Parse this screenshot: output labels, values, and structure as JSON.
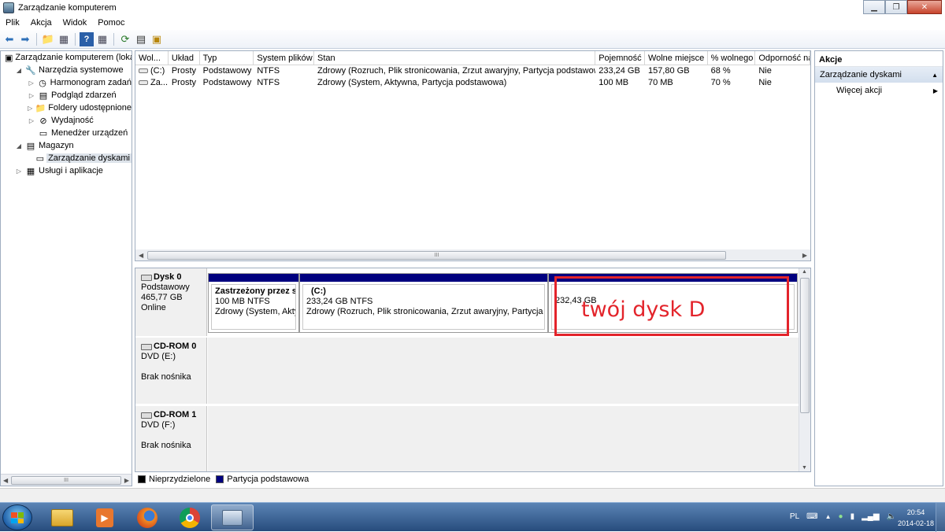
{
  "window": {
    "title": "Zarządzanie komputerem"
  },
  "menu": [
    "Plik",
    "Akcja",
    "Widok",
    "Pomoc"
  ],
  "tree": {
    "items": [
      {
        "label": "Zarządzanie komputerem (loka",
        "level": 0,
        "arrow": "",
        "icon": "computer-management-icon"
      },
      {
        "label": "Narzędzia systemowe",
        "level": 1,
        "arrow": "◢",
        "icon": "system-tools-icon"
      },
      {
        "label": "Harmonogram zadań",
        "level": 2,
        "arrow": "▷",
        "icon": "clock-icon"
      },
      {
        "label": "Podgląd zdarzeń",
        "level": 2,
        "arrow": "▷",
        "icon": "event-viewer-icon"
      },
      {
        "label": "Foldery udostępnione",
        "level": 2,
        "arrow": "▷",
        "icon": "shared-folder-icon"
      },
      {
        "label": "Wydajność",
        "level": 2,
        "arrow": "▷",
        "icon": "performance-icon"
      },
      {
        "label": "Menedżer urządzeń",
        "level": 2,
        "arrow": "",
        "icon": "device-manager-icon"
      },
      {
        "label": "Magazyn",
        "level": 1,
        "arrow": "◢",
        "icon": "storage-icon"
      },
      {
        "label": "Zarządzanie dyskami",
        "level": 2,
        "arrow": "",
        "icon": "disk-management-icon",
        "selected": true
      },
      {
        "label": "Usługi i aplikacje",
        "level": 1,
        "arrow": "▷",
        "icon": "services-icon"
      }
    ]
  },
  "volumes": {
    "columns": [
      "Wol...",
      "Układ",
      "Typ",
      "System plików",
      "Stan",
      "Pojemność",
      "Wolne miejsce",
      "% wolnego",
      "Odporność na"
    ],
    "rows": [
      [
        "(C:)",
        "Prosty",
        "Podstawowy",
        "NTFS",
        "Zdrowy (Rozruch, Plik stronicowania, Zrzut awaryjny, Partycja podstawowa)",
        "233,24 GB",
        "157,80 GB",
        "68 %",
        "Nie"
      ],
      [
        "Za...",
        "Prosty",
        "Podstawowy",
        "NTFS",
        "Zdrowy (System, Aktywna, Partycja podstawowa)",
        "100 MB",
        "70 MB",
        "70 %",
        "Nie"
      ]
    ]
  },
  "disks": {
    "disk0": {
      "name": "Dysk 0",
      "type": "Podstawowy",
      "size": "465,77 GB",
      "status": "Online",
      "partitions": [
        {
          "name": "Zastrzeżony przez sys",
          "size": "100 MB NTFS",
          "status": "Zdrowy (System, Aktyw"
        },
        {
          "name": "(C:)",
          "size": "233,24 GB NTFS",
          "status": "Zdrowy (Rozruch, Plik stronicowania, Zrzut awaryjny, Partycja poc"
        },
        {
          "name": "",
          "size": "232,43 GB",
          "status": ""
        }
      ]
    },
    "cdrom0": {
      "name": "CD-ROM 0",
      "drive": "DVD (E:)",
      "status": "Brak nośnika"
    },
    "cdrom1": {
      "name": "CD-ROM 1",
      "drive": "DVD (F:)",
      "status": "Brak nośnika"
    }
  },
  "legend": [
    {
      "label": "Nieprzydzielone",
      "color": "#000000"
    },
    {
      "label": "Partycja podstawowa",
      "color": "#00007f"
    }
  ],
  "actions": {
    "header": "Akcje",
    "section": "Zarządzanie dyskami",
    "more": "Więcej akcji"
  },
  "annotation": {
    "text": "twój dysk D",
    "color": "#e3242b"
  },
  "taskbar": {
    "language": "PL",
    "time": "20:54",
    "date": "2014-02-18",
    "apps": [
      "explorer-icon",
      "media-player-icon",
      "firefox-icon",
      "chrome-icon",
      "computer-management-icon"
    ]
  },
  "scroll_marker": "III"
}
